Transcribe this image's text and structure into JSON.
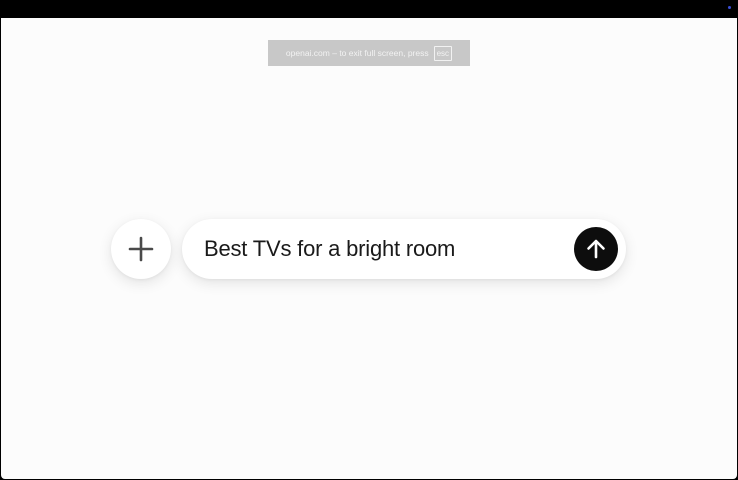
{
  "fullscreen_notice": {
    "message": "openai.com – to exit full screen, press",
    "key": "esc"
  },
  "composer": {
    "prompt_text": "Best TVs for a bright room",
    "add_icon": "plus-icon",
    "send_icon": "arrow-up-icon"
  },
  "colors": {
    "background": "#fcfcfc",
    "send_button": "#0d0d0d",
    "notice_bg": "#c8c8c8",
    "indicator": "#3b4fd8"
  }
}
